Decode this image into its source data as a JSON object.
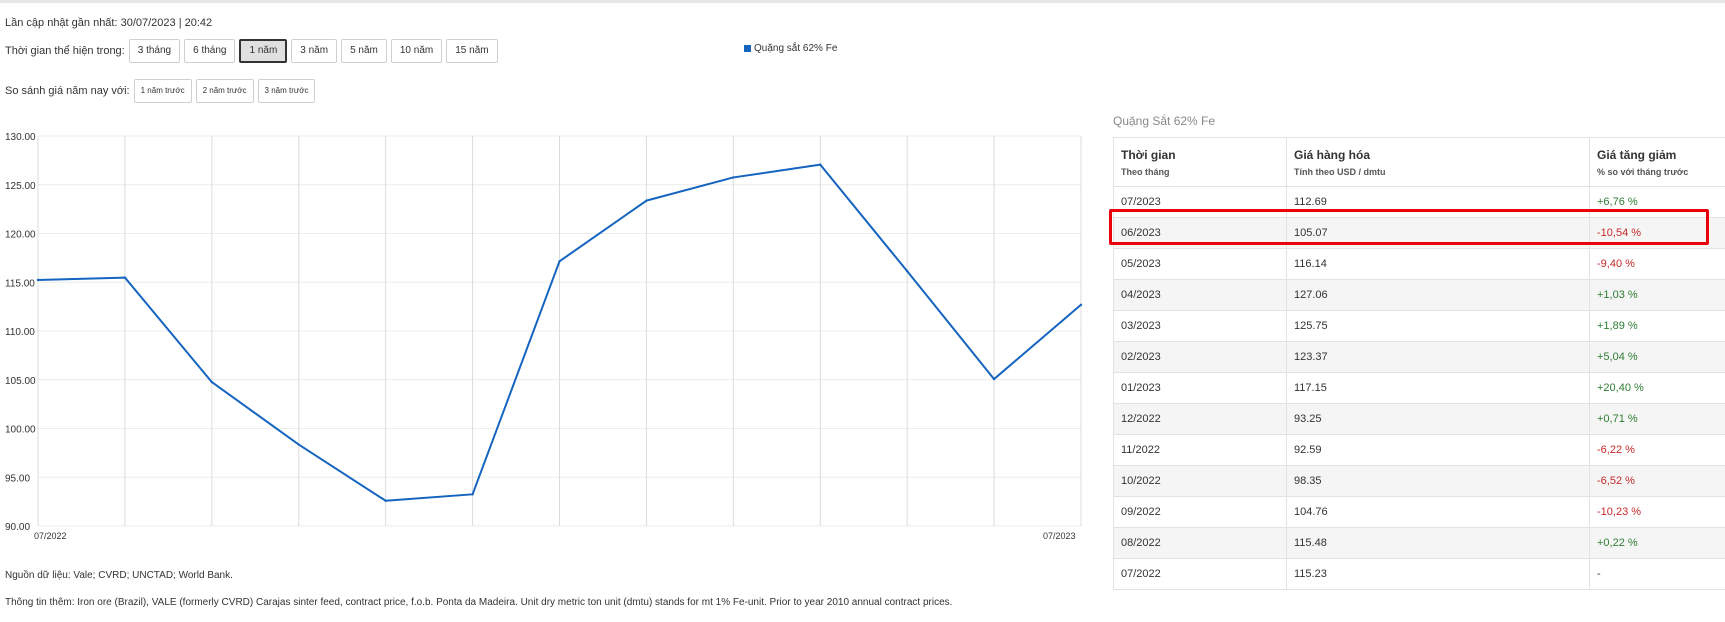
{
  "updated_text": "Lần cập nhật gần nhất: 30/07/2023 | 20:42",
  "period": {
    "label": "Thời gian thể hiện trong:",
    "buttons": [
      "3 tháng",
      "6 tháng",
      "1 năm",
      "3 năm",
      "5 năm",
      "10 năm",
      "15 năm"
    ],
    "active": "1 năm"
  },
  "compare": {
    "label": "So sánh giá năm nay với:",
    "buttons": [
      "1 năm trước",
      "2 năm trước",
      "3 năm trước"
    ]
  },
  "colors": {
    "series": "#1464c0",
    "highlight": "#e8000b",
    "positive": "#2e7d32",
    "negative": "#c62828"
  },
  "chart_data": {
    "type": "line",
    "legend": "Quặng sắt 62% Fe",
    "legend_position": "top-center",
    "x": [
      "07/2022",
      "08/2022",
      "09/2022",
      "10/2022",
      "11/2022",
      "12/2022",
      "01/2023",
      "02/2023",
      "03/2023",
      "04/2023",
      "05/2023",
      "06/2023",
      "07/2023"
    ],
    "x_tick_labels": [
      "07/2022",
      "07/2023"
    ],
    "series": [
      {
        "name": "Quặng sắt 62% Fe",
        "values": [
          115.23,
          115.48,
          104.76,
          98.35,
          92.59,
          93.25,
          117.15,
          123.37,
          125.75,
          127.06,
          116.14,
          105.07,
          112.69
        ]
      }
    ],
    "ylim": [
      90,
      130
    ],
    "y_ticks": [
      "130.00",
      "125.00",
      "120.00",
      "115.00",
      "110.00",
      "105.00",
      "100.00",
      "95.00",
      "90.00"
    ],
    "grid": true
  },
  "source_text": "Nguồn dữ liệu: Vale; CVRD; UNCTAD; World Bank.",
  "info_text": "Thông tin thêm: Iron ore (Brazil), VALE (formerly CVRD) Carajas sinter feed, contract price, f.o.b. Ponta da Madeira. Unit dry metric ton unit (dmtu) stands for mt 1% Fe-unit. Prior to year 2010 annual contract prices.",
  "table": {
    "title": "Quặng Sắt 62% Fe",
    "headers": [
      {
        "title": "Thời gian",
        "sub": "Theo tháng"
      },
      {
        "title": "Giá hàng hóa",
        "sub": "Tính theo USD / dmtu"
      },
      {
        "title": "Giá tăng giảm",
        "sub": "% so với tháng trước"
      }
    ],
    "rows": [
      {
        "month": "07/2023",
        "price": "112.69",
        "change": "+6,76 %",
        "dir": "pos"
      },
      {
        "month": "06/2023",
        "price": "105.07",
        "change": "-10,54 %",
        "dir": "neg"
      },
      {
        "month": "05/2023",
        "price": "116.14",
        "change": "-9,40 %",
        "dir": "neg"
      },
      {
        "month": "04/2023",
        "price": "127.06",
        "change": "+1,03 %",
        "dir": "pos"
      },
      {
        "month": "03/2023",
        "price": "125.75",
        "change": "+1,89 %",
        "dir": "pos"
      },
      {
        "month": "02/2023",
        "price": "123.37",
        "change": "+5,04 %",
        "dir": "pos"
      },
      {
        "month": "01/2023",
        "price": "117.15",
        "change": "+20,40 %",
        "dir": "pos"
      },
      {
        "month": "12/2022",
        "price": "93.25",
        "change": "+0,71 %",
        "dir": "pos"
      },
      {
        "month": "11/2022",
        "price": "92.59",
        "change": "-6,22 %",
        "dir": "neg"
      },
      {
        "month": "10/2022",
        "price": "98.35",
        "change": "-6,52 %",
        "dir": "neg"
      },
      {
        "month": "09/2022",
        "price": "104.76",
        "change": "-10,23 %",
        "dir": "neg"
      },
      {
        "month": "08/2022",
        "price": "115.48",
        "change": "+0,22 %",
        "dir": "pos"
      },
      {
        "month": "07/2022",
        "price": "115.23",
        "change": "-",
        "dir": "none"
      }
    ],
    "highlighted_row": "06/2023"
  }
}
